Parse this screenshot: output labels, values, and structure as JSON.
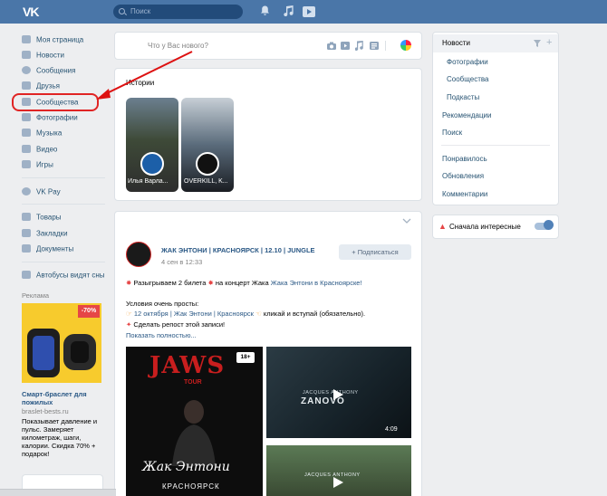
{
  "header": {
    "logo": "VK",
    "search_placeholder": "Поиск"
  },
  "menu": {
    "items": [
      {
        "label": "Моя страница"
      },
      {
        "label": "Новости"
      },
      {
        "label": "Сообщения"
      },
      {
        "label": "Друзья"
      },
      {
        "label": "Сообщества"
      },
      {
        "label": "Фотографии"
      },
      {
        "label": "Музыка"
      },
      {
        "label": "Видео"
      },
      {
        "label": "Игры"
      },
      {
        "label": "VK Pay"
      },
      {
        "label": "Товары"
      },
      {
        "label": "Закладки"
      },
      {
        "label": "Документы"
      },
      {
        "label": "Автобусы видят сны"
      }
    ],
    "ad": {
      "label": "Реклама",
      "badge": "-70%",
      "title": "Смарт-браслет для пожилых",
      "domain": "braslet-bests.ru",
      "text": "Показывает давление и пульс. Замеряет километраж, шаги, калории. Скидка 70% + подарок!"
    }
  },
  "composer": {
    "placeholder": "Что у Вас нового?"
  },
  "stories": {
    "title": "Истории",
    "items": [
      {
        "label": "Илья Варла..."
      },
      {
        "label": "OVERKILL, K..."
      }
    ]
  },
  "post": {
    "author": "ЖАК ЭНТОНИ | КРАСНОЯРСК | 12.10 | JUNGLE",
    "date": "4 сен в 12:33",
    "subscribe": "+ Подписаться",
    "line1_pre": "Разыгрываем 2 билета",
    "line1_mid": "на концерт Жака",
    "line1_link": "Жака Энтони в Красноярске!",
    "line2": "Условия очень просты:",
    "line3_link": "12 октября | Жак Энтони | Красноярск",
    "line3_post": "кликай и вступай (обязательно).",
    "line4": "Сделать репост этой записи!",
    "show_more": "Показать полностью...",
    "poster_title": "JAWS",
    "poster_sub": "TOUR",
    "poster_name": "Жак Энтони",
    "poster_city": "КРАСНОЯРСК",
    "poster_age": "18+",
    "video1_title": "ZANOVO",
    "video1_artist": "JACQUES ANTHONY",
    "video1_duration": "4:09",
    "video2_artist": "JACQUES ANTHONY"
  },
  "right": {
    "items": [
      {
        "label": "Новости"
      },
      {
        "label": "Фотографии"
      },
      {
        "label": "Сообщества"
      },
      {
        "label": "Подкасты"
      },
      {
        "label": "Рекомендации"
      },
      {
        "label": "Поиск"
      },
      {
        "label": "Понравилось"
      },
      {
        "label": "Обновления"
      },
      {
        "label": "Комментарии"
      }
    ],
    "interesting": "Сначала интересные"
  },
  "colors": {
    "header": "#4a76a8",
    "accent": "#e64646",
    "link": "#2a5885"
  }
}
